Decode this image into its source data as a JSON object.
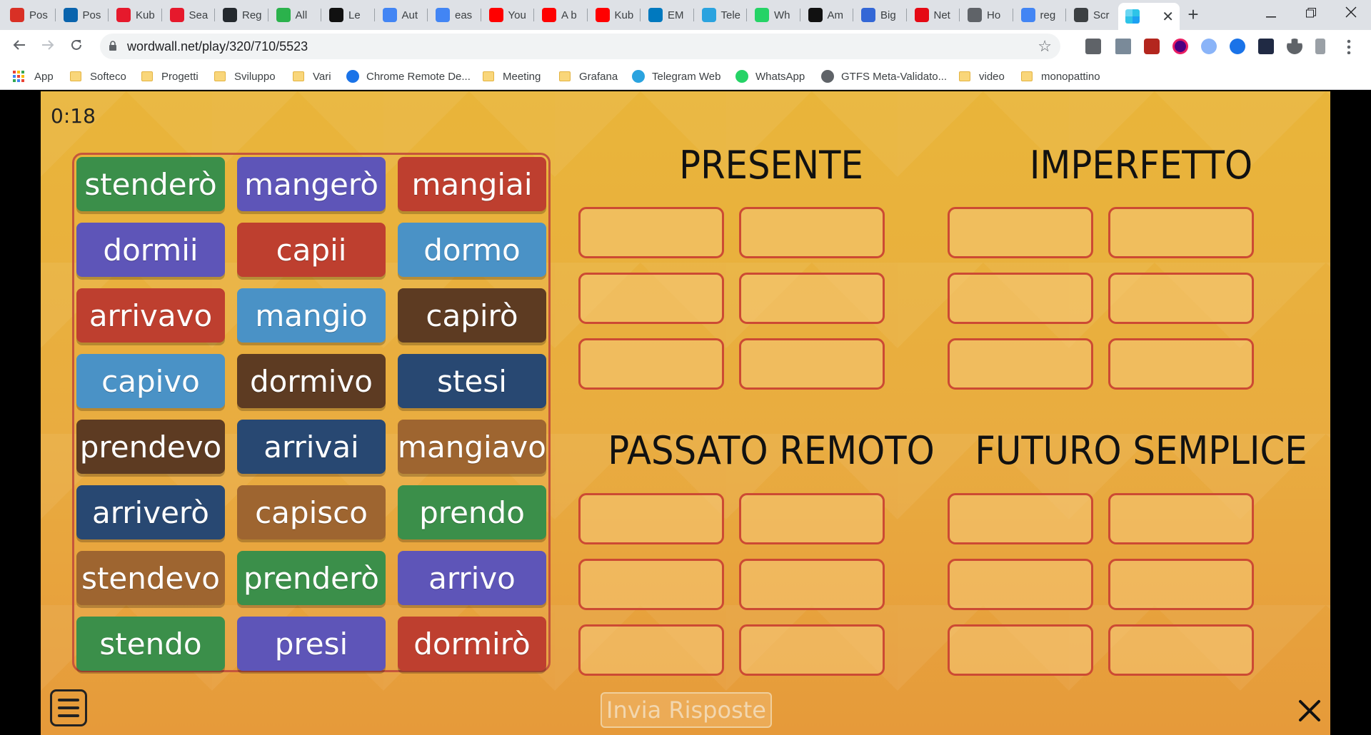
{
  "browser": {
    "tabs": [
      {
        "label": "Pos",
        "icon": "gmail-icon",
        "color": "#d93025"
      },
      {
        "label": "Pos",
        "icon": "outlook-icon",
        "color": "#0a64ad"
      },
      {
        "label": "Kub",
        "icon": "youtube-icon",
        "color": "#e6192c"
      },
      {
        "label": "Sea",
        "icon": "youtube-icon",
        "color": "#e6192c"
      },
      {
        "label": "Reg",
        "icon": "github-icon",
        "color": "#24292e"
      },
      {
        "label": "All",
        "icon": "feedly-icon",
        "color": "#2bb24c"
      },
      {
        "label": "Le",
        "icon": "r-icon",
        "color": "#111111"
      },
      {
        "label": "Aut",
        "icon": "google-icon",
        "color": "#4285f4"
      },
      {
        "label": "eas",
        "icon": "google-icon",
        "color": "#4285f4"
      },
      {
        "label": "You",
        "icon": "youtube-icon",
        "color": "#ff0000"
      },
      {
        "label": "A b",
        "icon": "youtube-icon",
        "color": "#ff0000"
      },
      {
        "label": "Kub",
        "icon": "youtube-icon",
        "color": "#ff0000"
      },
      {
        "label": "EM",
        "icon": "trello-icon",
        "color": "#0079bf"
      },
      {
        "label": "Tele",
        "icon": "telegram-icon",
        "color": "#2aa3df"
      },
      {
        "label": "Wh",
        "icon": "whatsapp-icon",
        "color": "#25d366"
      },
      {
        "label": "Am",
        "icon": "amazon-icon",
        "color": "#111111"
      },
      {
        "label": "Big",
        "icon": "bigquery-icon",
        "color": "#3367d6"
      },
      {
        "label": "Net",
        "icon": "netflix-icon",
        "color": "#e50914"
      },
      {
        "label": "Ho",
        "icon": "globe-icon",
        "color": "#5f6368"
      },
      {
        "label": "reg",
        "icon": "google-icon",
        "color": "#4285f4"
      },
      {
        "label": "Scr",
        "icon": "document-icon",
        "color": "#3c4043"
      }
    ],
    "active_tab_icon": "wordwall-icon",
    "active_tab_close": "✕",
    "new_tab": "+",
    "url": "wordwall.net/play/320/710/5523",
    "bookmarks": [
      {
        "label": "App",
        "type": "apps"
      },
      {
        "label": "Softeco",
        "type": "folder"
      },
      {
        "label": "Progetti",
        "type": "folder"
      },
      {
        "label": "Sviluppo",
        "type": "folder"
      },
      {
        "label": "Vari",
        "type": "folder"
      },
      {
        "label": "Chrome Remote De...",
        "type": "remote"
      },
      {
        "label": "Meeting",
        "type": "folder"
      },
      {
        "label": "Grafana",
        "type": "folder"
      },
      {
        "label": "Telegram Web",
        "type": "telegram"
      },
      {
        "label": "WhatsApp",
        "type": "whatsapp"
      },
      {
        "label": "GTFS Meta-Validato...",
        "type": "globe"
      },
      {
        "label": "video",
        "type": "folder"
      },
      {
        "label": "monopattino",
        "type": "folder"
      }
    ]
  },
  "game": {
    "timer": "0:18",
    "tiles": [
      {
        "word": "stenderò",
        "color": "#3b8f4a"
      },
      {
        "word": "mangerò",
        "color": "#5e55b8"
      },
      {
        "word": "mangiai",
        "color": "#be3f2f"
      },
      {
        "word": "dormii",
        "color": "#5e55b8"
      },
      {
        "word": "capii",
        "color": "#be3f2f"
      },
      {
        "word": "dormo",
        "color": "#4a92c6"
      },
      {
        "word": "arrivavo",
        "color": "#be3f2f"
      },
      {
        "word": "mangio",
        "color": "#4a92c6"
      },
      {
        "word": "capirò",
        "color": "#5d3b22"
      },
      {
        "word": "capivo",
        "color": "#4a92c6"
      },
      {
        "word": "dormivo",
        "color": "#5d3b22"
      },
      {
        "word": "stesi",
        "color": "#284872"
      },
      {
        "word": "prendevo",
        "color": "#5d3b22"
      },
      {
        "word": "arrivai",
        "color": "#284872"
      },
      {
        "word": "mangiavo",
        "color": "#9e6530"
      },
      {
        "word": "arriverò",
        "color": "#284872"
      },
      {
        "word": "capisco",
        "color": "#9e6530"
      },
      {
        "word": "prendo",
        "color": "#3b8f4a"
      },
      {
        "word": "stendevo",
        "color": "#9e6530"
      },
      {
        "word": "prenderò",
        "color": "#3b8f4a"
      },
      {
        "word": "arrivo",
        "color": "#5e55b8"
      },
      {
        "word": "stendo",
        "color": "#3b8f4a"
      },
      {
        "word": "presi",
        "color": "#5e55b8"
      },
      {
        "word": "dormirò",
        "color": "#be3f2f"
      }
    ],
    "categories": [
      {
        "title": "PRESENTE"
      },
      {
        "title": "IMPERFETTO"
      },
      {
        "title": "PASSATO REMOTO"
      },
      {
        "title": "FUTURO SEMPLICE"
      }
    ],
    "submit_label": "Invia Risposte"
  }
}
